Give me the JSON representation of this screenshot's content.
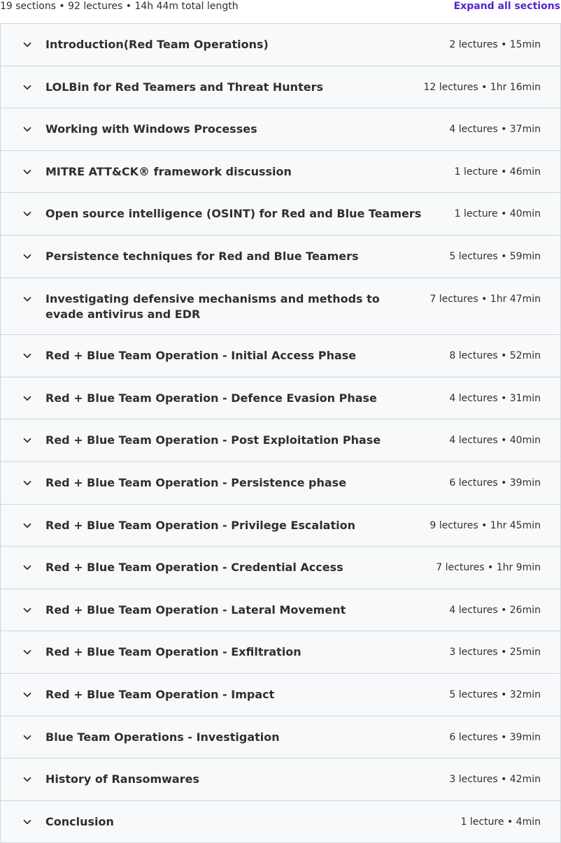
{
  "summary": {
    "text": "19 sections • 92 lectures • 14h 44m total length",
    "expand_all_label": "Expand all sections"
  },
  "icons": {
    "section_toggle": "chevron-down-icon"
  },
  "colors": {
    "accent": "#5624d0",
    "row_background": "#f7f9fa",
    "border": "#d1d7dc",
    "text": "#2d2f31"
  },
  "sections": [
    {
      "title": "Introduction(Red Team Operations)",
      "meta": "2 lectures • 15min"
    },
    {
      "title": "LOLBin for Red Teamers and Threat Hunters",
      "meta": "12 lectures • 1hr 16min"
    },
    {
      "title": "Working with Windows Processes",
      "meta": "4 lectures • 37min"
    },
    {
      "title": "MITRE ATT&CK® framework discussion",
      "meta": "1 lecture • 46min"
    },
    {
      "title": "Open source intelligence (OSINT) for Red and Blue Teamers",
      "meta": "1 lecture • 40min"
    },
    {
      "title": "Persistence techniques for Red and Blue Teamers",
      "meta": "5 lectures • 59min"
    },
    {
      "title": "Investigating defensive mechanisms and methods to evade antivirus and EDR",
      "meta": "7 lectures • 1hr 47min"
    },
    {
      "title": "Red + Blue Team Operation - Initial Access Phase",
      "meta": "8 lectures • 52min"
    },
    {
      "title": "Red + Blue Team Operation - Defence Evasion Phase",
      "meta": "4 lectures • 31min"
    },
    {
      "title": "Red + Blue Team Operation - Post Exploitation Phase",
      "meta": "4 lectures • 40min"
    },
    {
      "title": "Red + Blue Team Operation - Persistence phase",
      "meta": "6 lectures • 39min"
    },
    {
      "title": "Red + Blue Team Operation - Privilege Escalation",
      "meta": "9 lectures • 1hr 45min"
    },
    {
      "title": "Red + Blue Team Operation - Credential Access",
      "meta": "7 lectures • 1hr 9min"
    },
    {
      "title": "Red + Blue Team Operation - Lateral Movement",
      "meta": "4 lectures • 26min"
    },
    {
      "title": "Red + Blue Team Operation - Exfiltration",
      "meta": "3 lectures • 25min"
    },
    {
      "title": "Red + Blue Team Operation - Impact",
      "meta": "5 lectures • 32min"
    },
    {
      "title": "Blue Team Operations - Investigation",
      "meta": "6 lectures • 39min"
    },
    {
      "title": "History of Ransomwares",
      "meta": "3 lectures • 42min"
    },
    {
      "title": "Conclusion",
      "meta": "1 lecture • 4min"
    }
  ]
}
